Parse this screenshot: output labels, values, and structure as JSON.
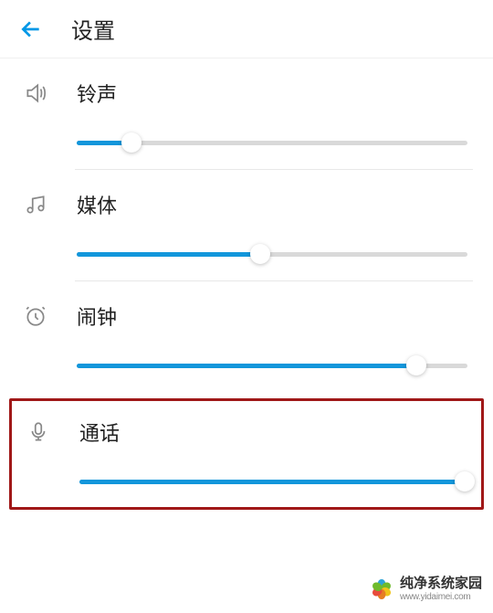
{
  "header": {
    "title": "设置",
    "colors": {
      "accent": "#1296db"
    }
  },
  "settings": {
    "ringtone": {
      "label": "铃声",
      "value": 14
    },
    "media": {
      "label": "媒体",
      "value": 47
    },
    "alarm": {
      "label": "闹钟",
      "value": 87
    },
    "call": {
      "label": "通话",
      "value": 100
    }
  },
  "watermark": {
    "name": "纯净系统家园",
    "url": "www.yidaimei.com"
  }
}
